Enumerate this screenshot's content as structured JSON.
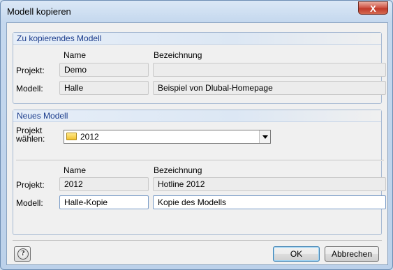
{
  "window": {
    "title": "Modell kopieren",
    "close_label": "X"
  },
  "source": {
    "header": "Zu kopierendes Modell",
    "col_name": "Name",
    "col_desc": "Bezeichnung",
    "row_project_label": "Projekt:",
    "row_model_label": "Modell:",
    "project_name": "Demo",
    "project_desc": "",
    "model_name": "Halle",
    "model_desc": "Beispiel von Dlubal-Homepage"
  },
  "target": {
    "header": "Neues Modell",
    "project_select_label_line1": "Projekt",
    "project_select_label_line2": "wählen:",
    "project_select_value": "2012",
    "col_name": "Name",
    "col_desc": "Bezeichnung",
    "row_project_label": "Projekt:",
    "row_model_label": "Modell:",
    "project_name": "2012",
    "project_desc": "Hotline 2012",
    "model_name": "Halle-Kopie",
    "model_desc": "Kopie des Modells"
  },
  "buttons": {
    "ok": "OK",
    "cancel": "Abbrechen"
  },
  "icons": {
    "help": "help-icon",
    "folder": "folder-icon",
    "dropdown": "chevron-down-icon",
    "close": "close-icon"
  }
}
